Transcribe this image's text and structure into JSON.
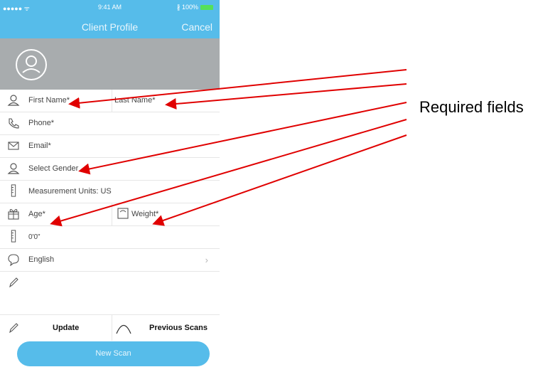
{
  "status_bar": {
    "signal": "●●●●● ᯤ",
    "time": "9:41 AM",
    "battery": "∦ 100%"
  },
  "nav": {
    "title": "Client Profile",
    "cancel": "Cancel"
  },
  "form": {
    "first_name": "First Name*",
    "last_name": "Last Name*",
    "phone": "Phone*",
    "email": "Email*",
    "gender": "Select Gender",
    "units": "Measurement Units: US",
    "age": "Age*",
    "weight": "Weight*",
    "height": "0'0\"",
    "language": "English",
    "language_chevron": "›"
  },
  "actions": {
    "update": "Update",
    "previous_scans": "Previous Scans",
    "new_scan": "New Scan"
  },
  "annotation": {
    "label": "Required fields",
    "arrow_color": "#e00000"
  },
  "colors": {
    "accent": "#56bcea",
    "photo_bg": "#a8acae"
  }
}
